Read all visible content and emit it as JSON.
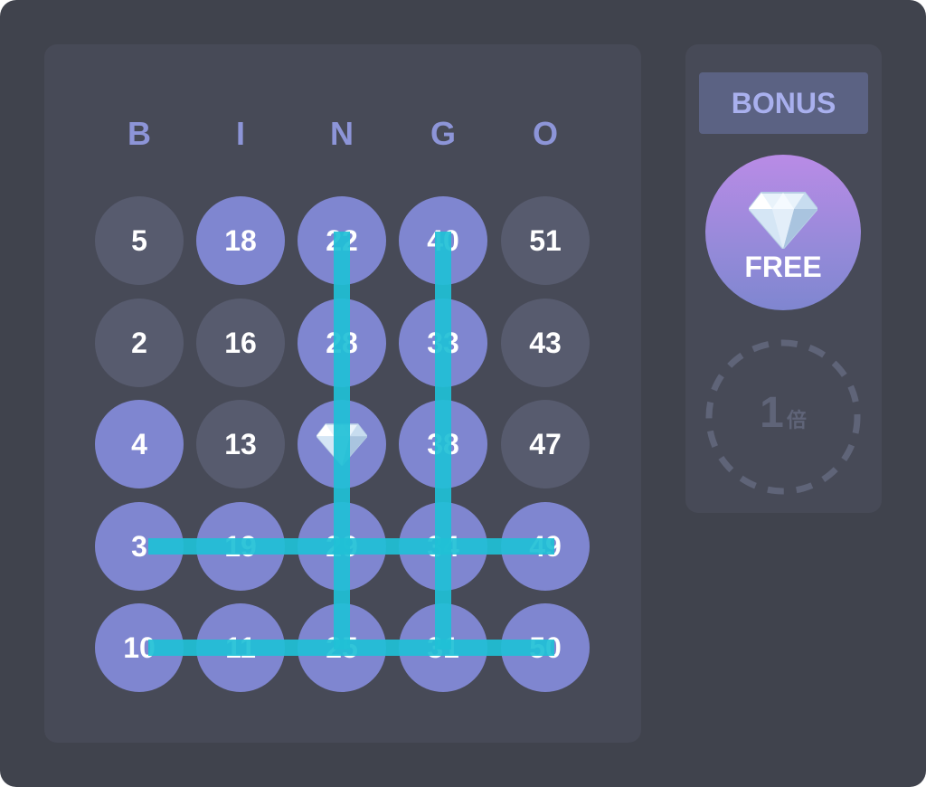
{
  "bingo": {
    "headers": [
      "B",
      "I",
      "N",
      "G",
      "O"
    ],
    "cells": [
      {
        "row": 0,
        "col": 0,
        "value": "5",
        "marked": false
      },
      {
        "row": 0,
        "col": 1,
        "value": "18",
        "marked": true
      },
      {
        "row": 0,
        "col": 2,
        "value": "22",
        "marked": true
      },
      {
        "row": 0,
        "col": 3,
        "value": "40",
        "marked": true
      },
      {
        "row": 0,
        "col": 4,
        "value": "51",
        "marked": false
      },
      {
        "row": 1,
        "col": 0,
        "value": "2",
        "marked": false
      },
      {
        "row": 1,
        "col": 1,
        "value": "16",
        "marked": false
      },
      {
        "row": 1,
        "col": 2,
        "value": "28",
        "marked": true
      },
      {
        "row": 1,
        "col": 3,
        "value": "33",
        "marked": true
      },
      {
        "row": 1,
        "col": 4,
        "value": "43",
        "marked": false
      },
      {
        "row": 2,
        "col": 0,
        "value": "4",
        "marked": true
      },
      {
        "row": 2,
        "col": 1,
        "value": "13",
        "marked": false
      },
      {
        "row": 2,
        "col": 2,
        "value": "",
        "marked": true,
        "icon": "diamond-icon"
      },
      {
        "row": 2,
        "col": 3,
        "value": "38",
        "marked": true
      },
      {
        "row": 2,
        "col": 4,
        "value": "47",
        "marked": false
      },
      {
        "row": 3,
        "col": 0,
        "value": "3",
        "marked": true
      },
      {
        "row": 3,
        "col": 1,
        "value": "19",
        "marked": true
      },
      {
        "row": 3,
        "col": 2,
        "value": "29",
        "marked": true
      },
      {
        "row": 3,
        "col": 3,
        "value": "34",
        "marked": true
      },
      {
        "row": 3,
        "col": 4,
        "value": "49",
        "marked": true
      },
      {
        "row": 4,
        "col": 0,
        "value": "10",
        "marked": true
      },
      {
        "row": 4,
        "col": 1,
        "value": "11",
        "marked": true
      },
      {
        "row": 4,
        "col": 2,
        "value": "25",
        "marked": true
      },
      {
        "row": 4,
        "col": 3,
        "value": "31",
        "marked": true
      },
      {
        "row": 4,
        "col": 4,
        "value": "50",
        "marked": true
      }
    ],
    "completed_lines": [
      {
        "type": "column",
        "index": 2
      },
      {
        "type": "column",
        "index": 3
      },
      {
        "type": "row",
        "index": 3
      },
      {
        "type": "row",
        "index": 4
      }
    ]
  },
  "bonus": {
    "tab_label": "BONUS",
    "free_label": "FREE",
    "free_icon": "diamond-icon",
    "multiplier_value": "1",
    "multiplier_unit": "倍"
  },
  "colors": {
    "background": "#40434d",
    "panel": "#474a57",
    "cell_unmarked": "#575b6e",
    "cell_marked": "#7f86d0",
    "header_text": "#8d95d8",
    "line": "#1fc0d6",
    "bonus_tab_bg": "#5b6283",
    "bonus_tab_text": "#a9b0ee",
    "free_gradient_top": "#b98be6",
    "free_gradient_bottom": "#7f86d0",
    "multiplier_ring": "#5f6478"
  }
}
